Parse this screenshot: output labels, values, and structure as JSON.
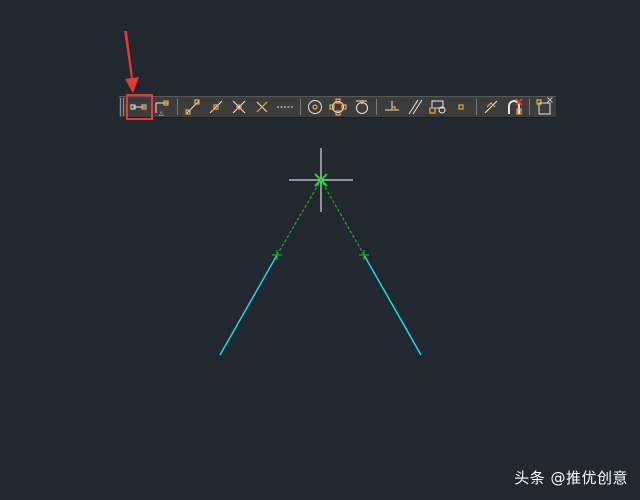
{
  "app": {
    "background": "#212830"
  },
  "toolbar": {
    "close_glyph": "×",
    "items": [
      {
        "type": "button",
        "name": "snap-to-endpoint-icon",
        "selected": true
      },
      {
        "type": "button",
        "name": "snap-to-midpoint-icon"
      },
      {
        "type": "sep"
      },
      {
        "type": "button",
        "name": "snap-to-intersection-icon"
      },
      {
        "type": "button",
        "name": "snap-to-apparent-intersection-icon"
      },
      {
        "type": "button",
        "name": "snap-to-extension-icon"
      },
      {
        "type": "button",
        "name": "snap-to-perpendicular-x-icon"
      },
      {
        "type": "button",
        "name": "snap-to-extension-dashed-icon"
      },
      {
        "type": "sep"
      },
      {
        "type": "button",
        "name": "snap-to-center-icon"
      },
      {
        "type": "button",
        "name": "snap-to-quadrant-icon"
      },
      {
        "type": "button",
        "name": "snap-to-tangent-icon"
      },
      {
        "type": "sep"
      },
      {
        "type": "button",
        "name": "snap-to-perpendicular-icon"
      },
      {
        "type": "button",
        "name": "snap-to-parallel-icon"
      },
      {
        "type": "button",
        "name": "snap-to-insert-icon"
      },
      {
        "type": "button",
        "name": "snap-to-node-icon"
      },
      {
        "type": "sep"
      },
      {
        "type": "button",
        "name": "snap-to-nearest-icon"
      },
      {
        "type": "button",
        "name": "snap-none-icon"
      },
      {
        "type": "sep"
      },
      {
        "type": "button",
        "name": "osnap-settings-icon"
      }
    ]
  },
  "annotation": {
    "arrow_color": "#e53935"
  },
  "drawing": {
    "line_color": "#1ed8e8",
    "tracking_color": "#1fae2a",
    "crosshair_color": "#ffffff"
  },
  "watermark": {
    "text": "头条 @推优创意"
  }
}
